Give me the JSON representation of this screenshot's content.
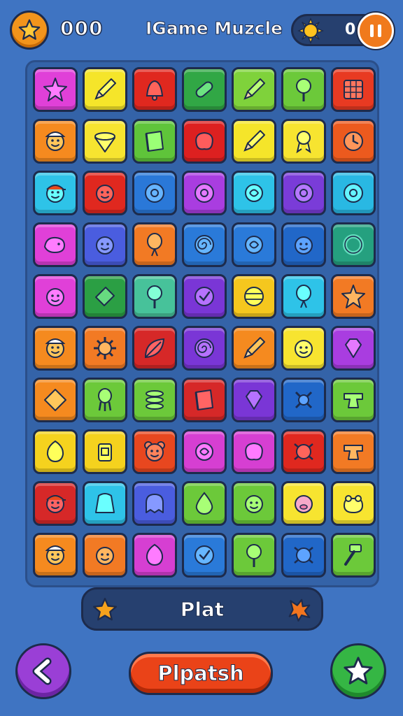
{
  "header": {
    "score": "000",
    "title": "IGame Muzcle",
    "sun_count": "0",
    "star_icon": "star-icon",
    "sun_icon": "sun-icon",
    "pause_icon": "pause-icon"
  },
  "colors": {
    "background": "#3f74c2",
    "board": "#3463a8",
    "outline": "#1d2b4c",
    "accent_orange": "#f07a1c",
    "button_red": "#ea4318",
    "button_purple": "#9a3fd6",
    "button_green": "#35b644"
  },
  "board": {
    "columns": 7,
    "rows": 10,
    "tiles": [
      [
        {
          "color": "#e040d8",
          "icon": "starfish-icon"
        },
        {
          "color": "#f5e52a",
          "icon": "pencil-icon"
        },
        {
          "color": "#e0281f",
          "icon": "bell-icon"
        },
        {
          "color": "#31a745",
          "icon": "capsule-icon"
        },
        {
          "color": "#7fd23b",
          "icon": "pencil-icon"
        },
        {
          "color": "#6cc93a",
          "icon": "lollipop-icon"
        },
        {
          "color": "#e83a22",
          "icon": "grid-icon"
        }
      ],
      [
        {
          "color": "#f58a1f",
          "icon": "face-hat-icon"
        },
        {
          "color": "#f7e430",
          "icon": "spinning-top-icon"
        },
        {
          "color": "#5fc43a",
          "icon": "book-icon"
        },
        {
          "color": "#dd2020",
          "icon": "blob-icon"
        },
        {
          "color": "#f5e52a",
          "icon": "pencil-icon"
        },
        {
          "color": "#f7e430",
          "icon": "ribbon-icon"
        },
        {
          "color": "#ec5a1e",
          "icon": "clock-icon"
        }
      ],
      [
        {
          "color": "#2ec3e8",
          "icon": "face-cap-icon"
        },
        {
          "color": "#e0281f",
          "icon": "face-icon"
        },
        {
          "color": "#2a78d8",
          "icon": "donut-icon"
        },
        {
          "color": "#a93de0",
          "icon": "donut-icon"
        },
        {
          "color": "#2ec3e8",
          "icon": "candy-icon"
        },
        {
          "color": "#7a3cd8",
          "icon": "donut-icon"
        },
        {
          "color": "#29b8e3",
          "icon": "donut-icon"
        }
      ],
      [
        {
          "color": "#e040d8",
          "icon": "whale-icon"
        },
        {
          "color": "#4a5ddf",
          "icon": "face-icon"
        },
        {
          "color": "#f27a24",
          "icon": "balloon-icon"
        },
        {
          "color": "#2a7ad9",
          "icon": "swirl-icon"
        },
        {
          "color": "#2a7ad9",
          "icon": "candy-icon"
        },
        {
          "color": "#2167c8",
          "icon": "face-icon"
        },
        {
          "color": "#25a07f",
          "icon": "ring-icon"
        }
      ],
      [
        {
          "color": "#e040d8",
          "icon": "face-icon"
        },
        {
          "color": "#2b9f44",
          "icon": "envelope-icon"
        },
        {
          "color": "#47c29a",
          "icon": "lollipop-icon"
        },
        {
          "color": "#7a36d6",
          "icon": "check-icon"
        },
        {
          "color": "#f5c71e",
          "icon": "ball-icon"
        },
        {
          "color": "#2ec3e8",
          "icon": "balloon-icon"
        },
        {
          "color": "#f27a24",
          "icon": "star-icon"
        }
      ],
      [
        {
          "color": "#f58a1f",
          "icon": "face-hat-icon"
        },
        {
          "color": "#f27a24",
          "icon": "gear-icon"
        },
        {
          "color": "#d62828",
          "icon": "leaf-icon"
        },
        {
          "color": "#7a36d6",
          "icon": "swirl-icon"
        },
        {
          "color": "#f58a1f",
          "icon": "pencil-icon"
        },
        {
          "color": "#f7e430",
          "icon": "face-icon"
        },
        {
          "color": "#a93de0",
          "icon": "gem-icon"
        }
      ],
      [
        {
          "color": "#f58a1f",
          "icon": "diamond-icon"
        },
        {
          "color": "#6cc93a",
          "icon": "squid-icon"
        },
        {
          "color": "#6cc93a",
          "icon": "spring-icon"
        },
        {
          "color": "#d62828",
          "icon": "book-icon"
        },
        {
          "color": "#7a36d6",
          "icon": "gem-icon"
        },
        {
          "color": "#2167c8",
          "icon": "molecule-icon"
        },
        {
          "color": "#6cc93a",
          "icon": "anvil-icon"
        }
      ],
      [
        {
          "color": "#f5d21e",
          "icon": "egg-icon"
        },
        {
          "color": "#f5d21e",
          "icon": "jar-icon"
        },
        {
          "color": "#e8471f",
          "icon": "bear-icon"
        },
        {
          "color": "#d63fd2",
          "icon": "candy-icon"
        },
        {
          "color": "#d63fd2",
          "icon": "blob-icon"
        },
        {
          "color": "#e0281f",
          "icon": "bug-icon"
        },
        {
          "color": "#f27a24",
          "icon": "anvil-icon"
        }
      ],
      [
        {
          "color": "#d62828",
          "icon": "face-cap-icon"
        },
        {
          "color": "#2ec3e8",
          "icon": "cloak-icon"
        },
        {
          "color": "#4a5ddf",
          "icon": "ghost-icon"
        },
        {
          "color": "#6cc93a",
          "icon": "drop-icon"
        },
        {
          "color": "#6cc93a",
          "icon": "face-icon"
        },
        {
          "color": "#f7e430",
          "icon": "pig-icon"
        },
        {
          "color": "#f7e430",
          "icon": "frog-icon"
        }
      ],
      [
        {
          "color": "#f58a1f",
          "icon": "face-hat-icon"
        },
        {
          "color": "#f27a24",
          "icon": "face-icon"
        },
        {
          "color": "#d63fd2",
          "icon": "egg-icon"
        },
        {
          "color": "#2a7ad9",
          "icon": "check-icon"
        },
        {
          "color": "#6cc93a",
          "icon": "lollipop-icon"
        },
        {
          "color": "#2167c8",
          "icon": "bug-icon"
        },
        {
          "color": "#6cc93a",
          "icon": "hammer-icon"
        }
      ]
    ]
  },
  "plat_bar": {
    "label": "Plat",
    "left_icon": "star-icon",
    "right_icon": "splat-icon"
  },
  "footer": {
    "back_icon": "back-arrow-icon",
    "main_button_label": "Plpatsh",
    "fav_icon": "star-icon"
  }
}
